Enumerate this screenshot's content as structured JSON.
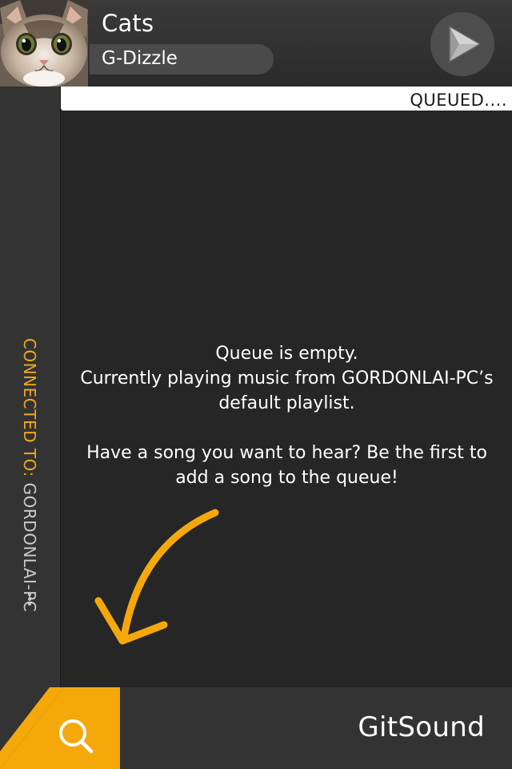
{
  "now_playing": {
    "title": "Cats",
    "artist": "G-Dizzle",
    "art_icon": "cat-photo",
    "play_icon": "play-icon"
  },
  "queue": {
    "status_label": "QUEUED....",
    "empty_lines": [
      "Queue is empty.",
      "Currently playing music from GORDONLAI-PC’s",
      "default playlist."
    ],
    "hint_lines": [
      "Have a song you want to hear? Be the first to",
      "add a song to the queue!"
    ]
  },
  "connection": {
    "label": "CONNECTED TO: ",
    "device": "GORDONLAI-PC",
    "menu_icon": "more-icon"
  },
  "footer": {
    "brand": "GitSound",
    "search_icon": "search-icon"
  },
  "colors": {
    "accent": "#f0a81c",
    "background": "#262626",
    "panel": "#333333",
    "text": "#ffffff"
  }
}
